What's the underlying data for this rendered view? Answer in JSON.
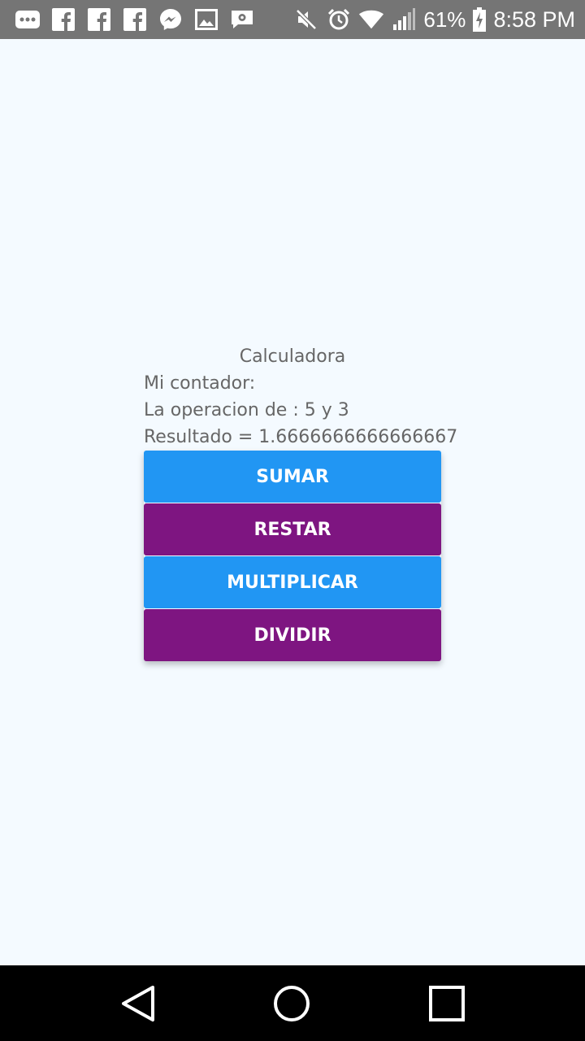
{
  "status_bar": {
    "icons_left": [
      "more-icon",
      "facebook-icon",
      "facebook-icon",
      "facebook-icon",
      "messenger-icon",
      "image-icon",
      "settings-message-icon"
    ],
    "icons_right": [
      "mute-icon",
      "alarm-icon",
      "wifi-icon",
      "signal-icon",
      "battery-charging-icon"
    ],
    "battery_percent": "61%",
    "time": "8:58 PM",
    "background_color": "#757575"
  },
  "app": {
    "title": "Calculadora",
    "counter_label": "Mi contador:",
    "operation_text": "La operacion de : 5 y 3",
    "result_text": "Resultado = 1.6666666666666667",
    "background_color": "#F4FAFF"
  },
  "buttons": [
    {
      "label": "SUMAR",
      "color": "#2196F3"
    },
    {
      "label": "RESTAR",
      "color": "#7E1581"
    },
    {
      "label": "MULTIPLICAR",
      "color": "#2196F3"
    },
    {
      "label": "DIVIDIR",
      "color": "#7E1581"
    }
  ],
  "nav_bar": {
    "buttons": [
      "back-icon",
      "home-icon",
      "recents-icon"
    ]
  }
}
